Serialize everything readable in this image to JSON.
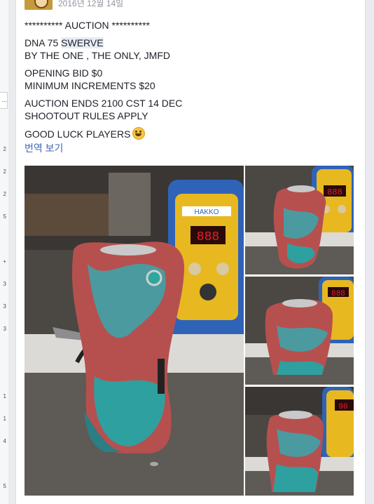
{
  "post": {
    "date": "2016년 12월 14일",
    "lines": [
      "********** AUCTION **********",
      "DNA 75 ",
      "BY THE ONE , THE ONLY, JMFD",
      "OPENING BID $0",
      "MINIMUM INCREMENTS $20",
      "AUCTION ENDS 2100 CST 14 DEC",
      "SHOOTOUT RULES APPLY",
      "GOOD LUCK PLAYERS"
    ],
    "highlight_word": "SWERVE",
    "emoji": "grinning-face-emoji",
    "translate_link": "번역 보기"
  },
  "photos": {
    "display_text": "888",
    "display_text_partial": "90",
    "brand_text": "HAKKO"
  },
  "left_strip": {
    "marks": [
      "2",
      "2",
      "2",
      "5",
      "+",
      "3",
      "3",
      "3",
      "1",
      "1",
      "4",
      "5"
    ],
    "ellipsis": "..."
  },
  "colors": {
    "link": "#4267b2",
    "text": "#1d2129",
    "meta": "#90949c",
    "display_red": "#e8202a",
    "station_yellow": "#e8b820",
    "station_blue": "#2e63b8"
  }
}
